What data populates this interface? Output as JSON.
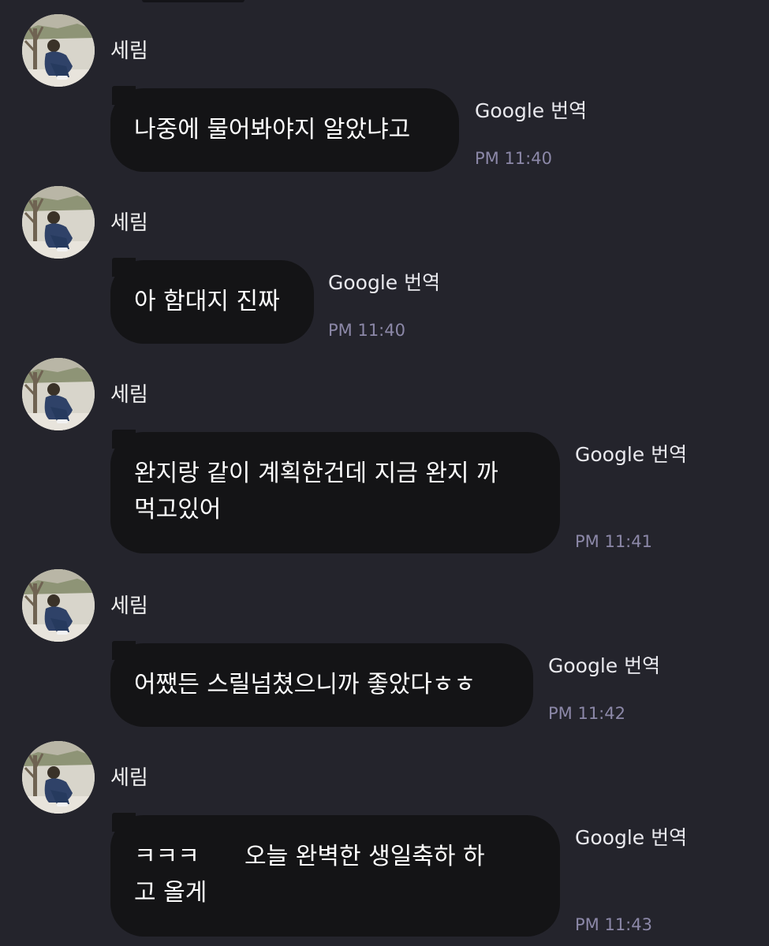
{
  "messages": [
    {
      "sender": "세림",
      "text": "나중에 물어봐야지 알았냐고",
      "translate_label": "Google 번역",
      "time": "PM 11:40"
    },
    {
      "sender": "세림",
      "text": "아 함대지 진짜",
      "translate_label": "Google 번역",
      "time": "PM 11:40"
    },
    {
      "sender": "세림",
      "text": "완지랑 같이 계획한건데 지금 완지 까\n먹고있어",
      "translate_label": "Google 번역",
      "time": "PM 11:41"
    },
    {
      "sender": "세림",
      "text": "어쨌든 스릴넘쳤으니까 좋았다ㅎㅎ",
      "translate_label": "Google 번역",
      "time": "PM 11:42"
    },
    {
      "sender": "세림",
      "text": "ㅋㅋㅋ      오늘 완벽한 생일축하 하\n고 올게",
      "translate_label": "Google 번역",
      "time": "PM 11:43"
    }
  ],
  "colors": {
    "background": "#24242c",
    "bubble": "#141416",
    "timestamp": "#8c88a8"
  }
}
